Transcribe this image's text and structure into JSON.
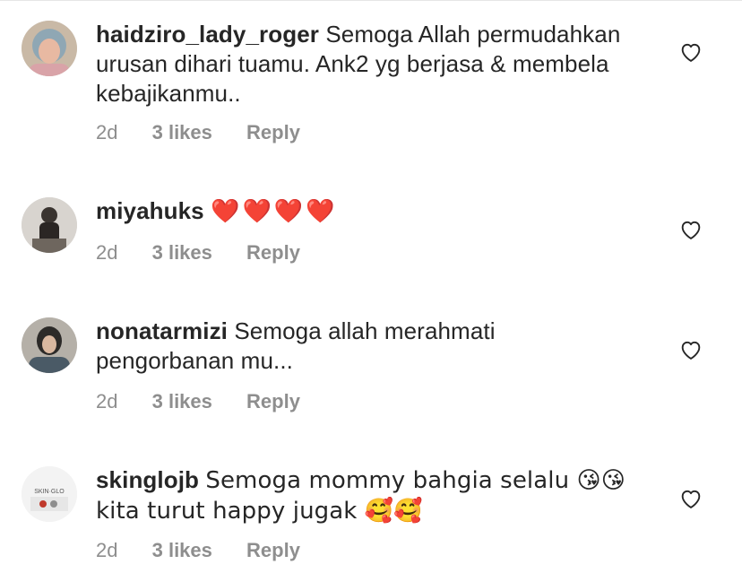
{
  "comments": [
    {
      "username": "haidziro_lady_roger",
      "text": "Semoga Allah permudahkan urusan dihari tuamu. Ank2 yg berjasa & membela kebajikanmu..",
      "time": "2d",
      "likes": "3 likes",
      "reply": "Reply"
    },
    {
      "username": "miyahuks",
      "text": "❤️❤️❤️❤️",
      "time": "2d",
      "likes": "3 likes",
      "reply": "Reply"
    },
    {
      "username": "nonatarmizi",
      "text": "Semoga allah merahmati pengorbanan mu...",
      "time": "2d",
      "likes": "3 likes",
      "reply": "Reply"
    },
    {
      "username": "skinglojb",
      "text": "Semoga mommy bahgia selalu 😘😘 kita turut happy jugak 🥰🥰",
      "time": "2d",
      "likes": "3 likes",
      "reply": "Reply",
      "avatar_logo": "SKIN·GLO"
    }
  ],
  "icons": {
    "like": "heart-outline-icon"
  },
  "colors": {
    "text": "#262626",
    "meta": "#8e8e8e",
    "heart_emoji": "#e0242e"
  }
}
